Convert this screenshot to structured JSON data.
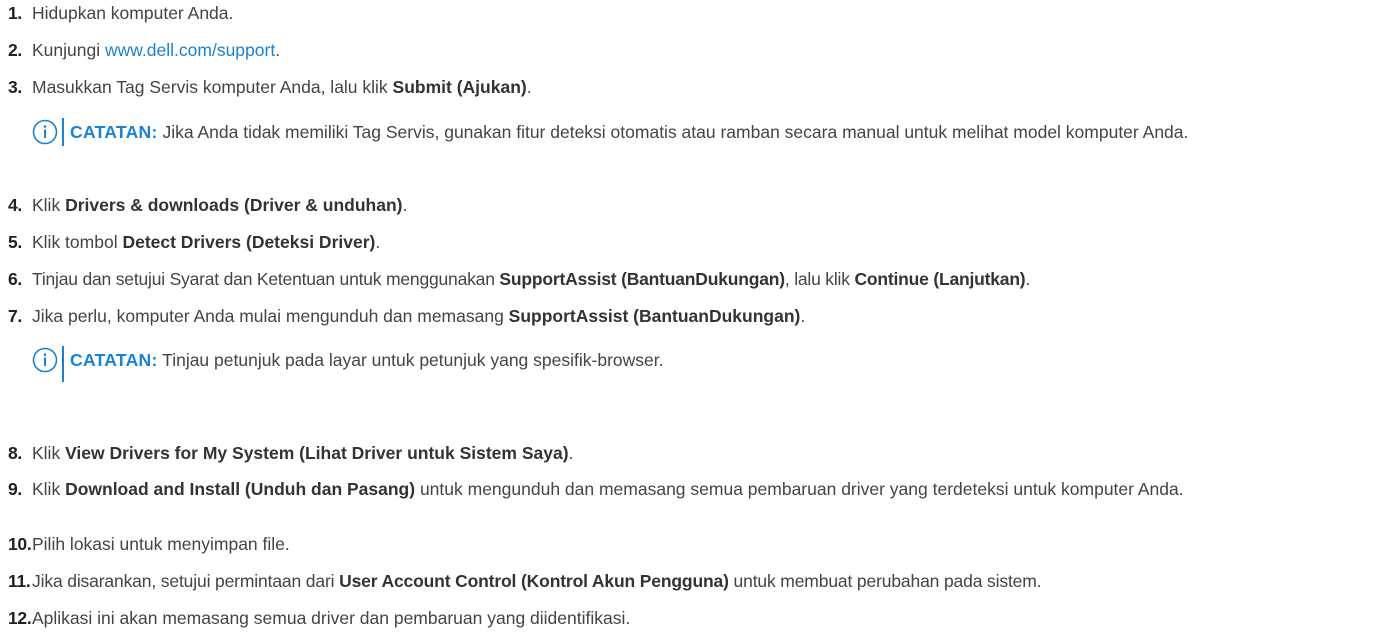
{
  "steps": [
    {
      "num": "1.",
      "parts": [
        "Hidupkan komputer Anda."
      ]
    },
    {
      "num": "2.",
      "before": "Kunjungi ",
      "link": "www.dell.com/support",
      "after": "."
    },
    {
      "num": "3.",
      "before": "Masukkan Tag Servis komputer Anda, lalu klik ",
      "bold": "Submit (Ajukan)",
      "after": "."
    },
    {
      "num": "4.",
      "before": "Klik ",
      "bold": "Drivers & downloads (Driver & unduhan)",
      "after": "."
    },
    {
      "num": "5.",
      "before": "Klik tombol ",
      "bold": "Detect Drivers (Deteksi Driver)",
      "after": "."
    },
    {
      "num": "6.",
      "before": "Tinjau dan setujui Syarat dan Ketentuan untuk menggunakan ",
      "bold": "SupportAssist (BantuanDukungan)",
      "mid": ", lalu klik ",
      "bold2": "Continue (Lanjutkan)",
      "after": "."
    },
    {
      "num": "7.",
      "before": "Jika perlu, komputer Anda mulai mengunduh dan memasang ",
      "bold": "SupportAssist (BantuanDukungan)",
      "after": "."
    },
    {
      "num": "8.",
      "before": "Klik ",
      "bold": "View Drivers for My System (Lihat Driver untuk Sistem Saya)",
      "after": "."
    },
    {
      "num": "9.",
      "before": "Klik ",
      "bold": "Download and Install (Unduh dan Pasang)",
      "after": " untuk mengunduh dan memasang semua pembaruan driver yang terdeteksi untuk komputer Anda."
    },
    {
      "num": "10.",
      "parts": [
        "Pilih lokasi untuk menyimpan file."
      ]
    },
    {
      "num": "11.",
      "before": "Jika disarankan, setujui permintaan dari ",
      "bold": "User Account Control (Kontrol Akun Pengguna)",
      "after": " untuk membuat perubahan pada sistem."
    },
    {
      "num": "12.",
      "parts": [
        "Aplikasi ini akan memasang semua driver dan pembaruan yang diidentifikasi."
      ]
    }
  ],
  "notes": [
    {
      "label": "CATATAN:",
      "text": " Jika Anda tidak memiliki Tag Servis, gunakan fitur deteksi otomatis atau ramban secara manual untuk melihat model komputer Anda."
    },
    {
      "label": "CATATAN:",
      "text": " Tinjau petunjuk pada layar untuk petunjuk yang spesifik-browser."
    }
  ],
  "colors": {
    "accent": "#1a82d4",
    "text": "#444444"
  },
  "icons": {
    "note": "info-circle-icon"
  }
}
